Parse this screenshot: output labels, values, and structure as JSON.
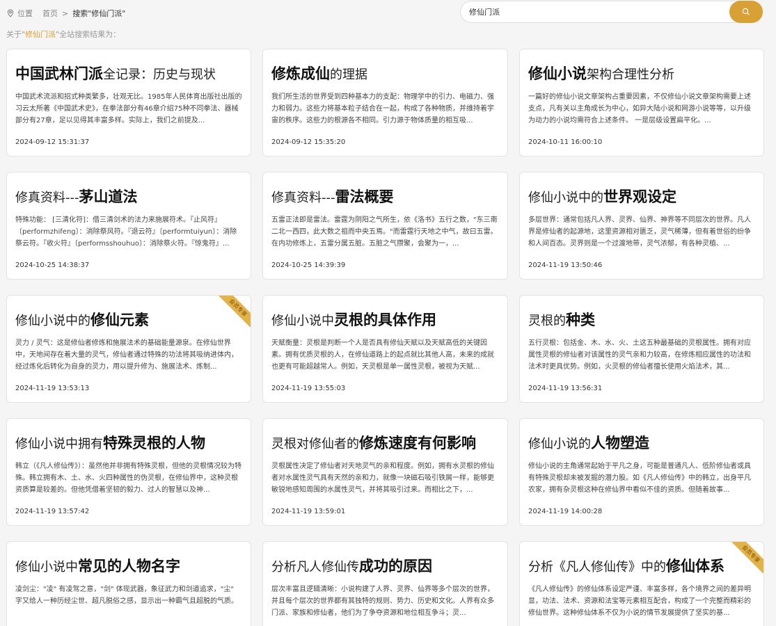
{
  "breadcrumb": {
    "label": "位置",
    "home": "首页",
    "separator": ">",
    "current": "搜索\"修仙门派\""
  },
  "search": {
    "value": "修仙门派",
    "button_icon": "search-icon"
  },
  "summary": {
    "prefix": "关于\"",
    "keyword": "修仙门派",
    "suffix": "\"全站搜索结果为："
  },
  "badge_label": "会员专享",
  "colors": {
    "accent": "#d9a035",
    "badge": "#e3b34a",
    "background": "#f5f5f5"
  },
  "articles": [
    {
      "pre": "",
      "hl": "中国武林门派",
      "post": "全记录：历史与现状",
      "desc": "中国武术流派和招式种类繁多，壮观无比。1985年人民体育出版社出版的习云太所著《中国武术史》，在拳法部分有46章介绍75种不同拳法、器械部分有27章，足以见得其丰富多样。实际上，我们之前提及...",
      "date": "2024-09-12 15:31:37"
    },
    {
      "pre": "",
      "hl": "修炼成仙",
      "post": "的理据",
      "desc": "我们所生活的世界受到四种基本力的支配：物理学中的引力、电磁力、强力和弱力。这些力将基本粒子结合在一起，构成了各种物质，并维持着宇宙的秩序。这些力的根源各不相同。引力源于物体质量的相互吸...",
      "date": "2024-09-12 15:35:20"
    },
    {
      "pre": "",
      "hl": "修仙小说",
      "post": "架构合理性分析",
      "desc": "一篇好的修仙小说文章架构占重要因素，不仅修仙小说文章架构需要上述支点，凡有关以主角成长为中心，如异大陆小说和网游小说等等，以升级为动力的小说均需符合上述条件。 一是层级设置扁平化。...",
      "date": "2024-10-11 16:00:10"
    },
    {
      "pre": "修真资料---",
      "hl": "茅山道法",
      "post": "",
      "desc": "特殊功能： [三清化符]：借三清剑术的法力来施展符术。『止风符』〔performzhifeng〕：消除祭风符。『退云符』〔performtuiyun〕：消除祭云符。『收火符』〔performsshouhuo〕：消除祭火符。『惊鬼符』...",
      "date": "2024-10-25 14:38:37"
    },
    {
      "pre": "修真资料---",
      "hl": "雷法概要",
      "post": "",
      "desc": "五雷正法即是雷法。雷霆为阴阳之气所生，依《洛书》五行之数，\"东三南二北一西四，此大数之祖而中央五焉。\"而雷霆行天地之中气，故曰五雷。 在内功修炼上，五雷分属五脏。五脏之气攒聚，会聚为一，...",
      "date": "2024-10-25 14:39:39"
    },
    {
      "pre": "修仙小说中的",
      "hl": "世界观设定",
      "post": "",
      "desc": "多层世界：通常包括凡人界、灵界、仙界、神界等不同层次的世界。凡人界是修仙者的起源地，这里资源相对匮乏，灵气稀薄，但有着世俗的纷争和人间百态。灵界则是一个过渡地带，灵气浓郁，有各种灵植、...",
      "date": "2024-11-19 13:50:46"
    },
    {
      "pre": "修仙小说中的",
      "hl": "修仙元素",
      "post": "",
      "desc": "灵力 / 灵气：这是修仙者修炼和施展法术的基础能量源泉。在修仙世界中，天地间存在着大量的灵气，修仙者通过特殊的功法将其吸纳进体内，经过炼化后转化为自身的灵力，用以提升修为、施展法术、炼制...",
      "date": "2024-11-19 13:53:13",
      "badge": true
    },
    {
      "pre": "修仙小说中",
      "hl": "灵根的具体作用",
      "post": "",
      "desc": "天赋衡量：灵根是判断一个人是否具有修仙天赋以及天赋高低的关键因素。拥有优质灵根的人，在修仙道路上的起点就比其他人高，未来的成就也更有可能超越常人。例如，天灵根是单一属性灵根，被视为天赋...",
      "date": "2024-11-19 13:55:03"
    },
    {
      "pre": "灵根的",
      "hl": "种类",
      "post": "",
      "desc": "五行灵根：包括金、木、水、火、土这五种最基础的灵根属性。拥有对应属性灵根的修仙者对该属性的灵气亲和力较高，在修炼相应属性的功法和法术时更具优势。例如，火灵根的修仙者擅长使用火焰法术，其...",
      "date": "2024-11-19 13:56:31"
    },
    {
      "pre": "修仙小说中拥有",
      "hl": "特殊灵根的人物",
      "post": "",
      "desc": "韩立（《凡人修仙传》）：虽然他并非拥有特殊灵根，但他的灵根情况较为特殊。韩立拥有木、土、水、火四种属性的伪灵根，在修仙界中，这种灵根资质算是较差的。但他凭借着坚韧的毅力、过人的智慧以及神...",
      "date": "2024-11-19 13:57:42"
    },
    {
      "pre": "灵根对修仙者的",
      "hl": "修炼速度有何影响",
      "post": "",
      "desc": "灵根属性决定了修仙者对天地灵气的亲和程度。例如，拥有水灵根的修仙者对水属性灵气具有天然的亲和力，就像一块磁石吸引铁屑一样，能够更敏锐地感知周围的水属性灵气，并将其吸引过来。而相比之下，...",
      "date": "2024-11-19 13:59:01"
    },
    {
      "pre": "修仙小说的",
      "hl": "人物塑造",
      "post": "",
      "desc": "修仙小说的主角通常起始于平凡之身，可能是普通凡人、低阶修仙者或具有特殊灵根却未被发掘的潜力股。如《凡人修仙传》中的韩立，出身平凡农家，拥有杂灵根这种在修仙界中看似不佳的资质。但随着故事...",
      "date": "2024-11-19 14:00:28"
    },
    {
      "pre": "修仙小说中",
      "hl": "常见的人物名字",
      "post": "",
      "desc": "凌剑尘：\"凌\" 有凌驾之意，\"剑\" 体现武器，象征武力和剑道追求，\"尘\" 字又给人一种历经尘世、超凡脱俗之感，显示出一种霸气且超脱的气质。",
      "date": ""
    },
    {
      "pre": "分析凡人修仙传",
      "hl": "成功的原因",
      "post": "",
      "desc": "层次丰富且逻辑清晰：小说构建了人界、灵界、仙界等多个层次的世界，并且每个层次的世界都有其独特的规则、势力、历史和文化。人界有众多门派、家族和修仙者，他们为了争夺资源和地位相互争斗；灵...",
      "date": ""
    },
    {
      "pre": "分析《凡人修仙传》中的",
      "hl": "修仙体系",
      "post": "",
      "desc": "《凡人修仙传》的修仙体系设定严谨、丰富多样，各个境界之间的差异明显，功法、法术、资源和法宝等元素相互配合，构成了一个完整而精彩的修仙世界。这种修仙体系不仅为小说的情节发展提供了坚实的基...",
      "date": "",
      "badge": true
    }
  ]
}
